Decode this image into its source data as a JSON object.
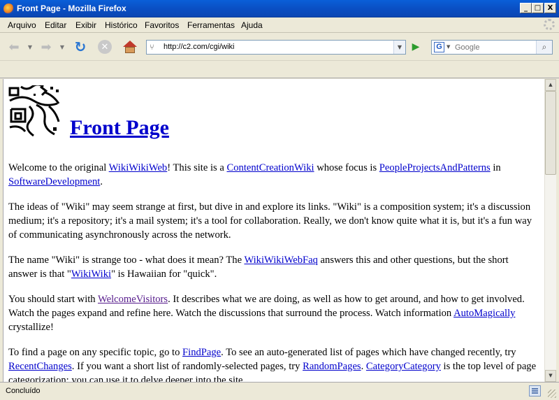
{
  "window": {
    "title": "Front Page - Mozilla Firefox",
    "controls": {
      "minimize": "_",
      "maximize": "□",
      "close": "X"
    }
  },
  "menu": [
    "Arquivo",
    "Editar",
    "Exibir",
    "Histórico",
    "Favoritos",
    "Ferramentas",
    "Ajuda"
  ],
  "navigation": {
    "url": "http://c2.com/cgi/wiki",
    "search_placeholder": "Google",
    "search_engine_letter": "G"
  },
  "page": {
    "title": "Front Page",
    "paragraphs": [
      [
        {
          "t": "Welcome to the original "
        },
        {
          "link": "WikiWikiWeb"
        },
        {
          "t": "! This site is a "
        },
        {
          "link": "ContentCreationWiki"
        },
        {
          "t": " whose focus is "
        },
        {
          "link": "PeopleProjectsAndPatterns"
        },
        {
          "t": " in "
        },
        {
          "link": "SoftwareDevelopment"
        },
        {
          "t": "."
        }
      ],
      [
        {
          "t": "The ideas of \"Wiki\" may seem strange at first, but dive in and explore its links. \"Wiki\" is a composition system; it's a discussion medium; it's a repository; it's a mail system; it's a tool for collaboration. Really, we don't know quite what it is, but it's a fun way of communicating asynchronously across the network."
        }
      ],
      [
        {
          "t": "The name \"Wiki\" is strange too - what does it mean? The "
        },
        {
          "link": "WikiWikiWebFaq"
        },
        {
          "t": " answers this and other questions, but the short answer is that \""
        },
        {
          "link": "WikiWiki"
        },
        {
          "t": "\" is Hawaiian for \"quick\"."
        }
      ],
      [
        {
          "t": "You should start with "
        },
        {
          "link": "WelcomeVisitors",
          "visited": true
        },
        {
          "t": ". It describes what we are doing, as well as how to get around, and how to get involved. Watch the pages expand and refine here. Watch the discussions that surround the process. Watch information "
        },
        {
          "link": "AutoMagically"
        },
        {
          "t": " crystallize!"
        }
      ],
      [
        {
          "t": "To find a page on any specific topic, go to "
        },
        {
          "link": "FindPage"
        },
        {
          "t": ". To see an auto-generated list of pages which have changed recently, try "
        },
        {
          "link": "RecentChanges"
        },
        {
          "t": ". If you want a short list of randomly-selected pages, try "
        },
        {
          "link": "RandomPages"
        },
        {
          "t": ". "
        },
        {
          "link": "CategoryCategory"
        },
        {
          "t": " is the top level of page categorization; you can use it to delve deeper into the site."
        }
      ]
    ]
  },
  "status": {
    "text": "Concluído"
  }
}
